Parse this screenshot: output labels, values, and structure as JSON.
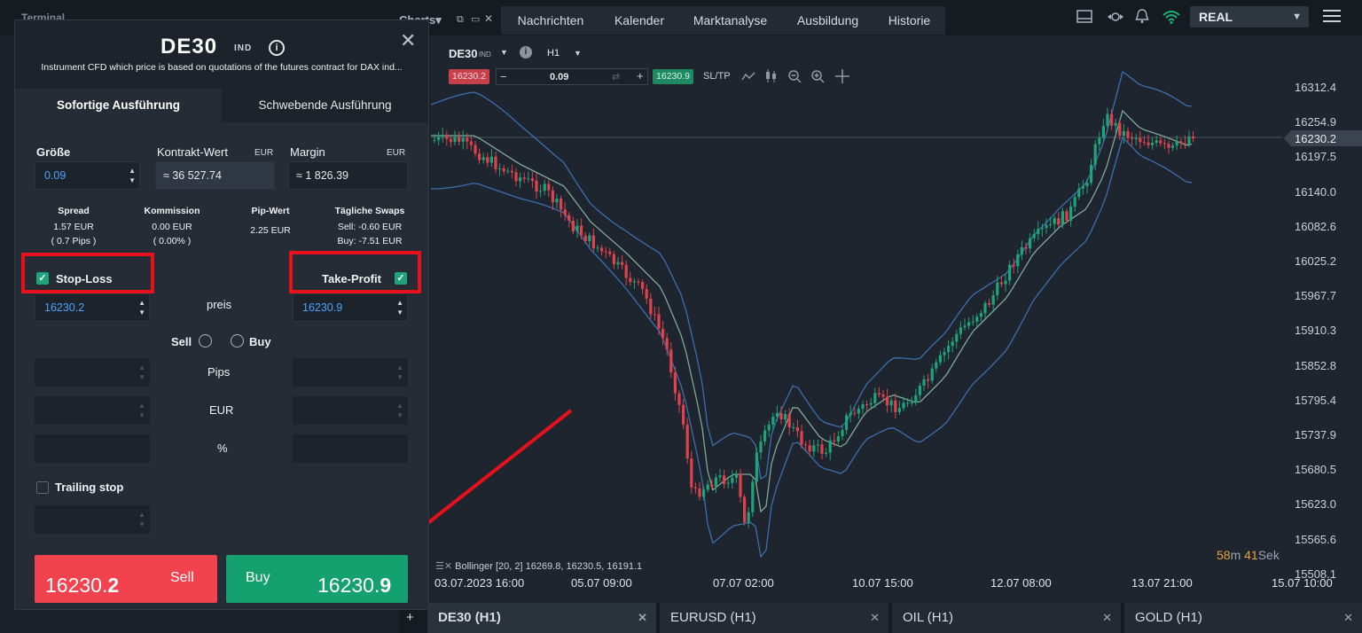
{
  "top_nav": {
    "terminal_label": "Terminal",
    "charts_label": "Charts",
    "tabs": [
      "Nachrichten",
      "Kalender",
      "Marktanalyse",
      "Ausbildung",
      "Historie"
    ],
    "account_mode": "REAL"
  },
  "order_panel": {
    "symbol": "DE30",
    "symbol_type": "IND",
    "description": "Instrument CFD which price is based on quotations of the futures contract for DAX ind...",
    "tab_instant": "Sofortige Ausführung",
    "tab_pending": "Schwebende Ausführung",
    "size_label": "Größe",
    "size_value": "0.09",
    "contract_label": "Kontrakt-Wert",
    "contract_unit": "EUR",
    "contract_value": "≈ 36 527.74",
    "margin_label": "Margin",
    "margin_unit": "EUR",
    "margin_value": "≈ 1 826.39",
    "stats": {
      "spread_label": "Spread",
      "spread_value": "1.57 EUR",
      "spread_pips": "( 0.7 Pips )",
      "commission_label": "Kommission",
      "commission_value": "0.00 EUR",
      "commission_pct": "( 0.00% )",
      "pip_label": "Pip-Wert",
      "pip_value": "2.25 EUR",
      "swaps_label": "Tägliche Swaps",
      "swaps_sell": "Sell: -0.60 EUR",
      "swaps_buy": "Buy: -7.51 EUR"
    },
    "stop_loss_label": "Stop-Loss",
    "stop_loss_value": "16230.2",
    "take_profit_label": "Take-Profit",
    "take_profit_value": "16230.9",
    "price_label": "preis",
    "sell_radio_label": "Sell",
    "buy_radio_label": "Buy",
    "pips_label": "Pips",
    "eur_label": "EUR",
    "pct_label": "%",
    "trailing_label": "Trailing stop",
    "sell_button": {
      "price_main": "16230.",
      "price_big": "2",
      "label": "Sell"
    },
    "buy_button": {
      "label": "Buy",
      "price_main": "16230.",
      "price_big": "9"
    }
  },
  "chart_toolbar": {
    "symbol": "DE30",
    "symbol_type": "IND",
    "timeframe": "H1",
    "bid": "16230.2",
    "volume": "0.09",
    "ask": "16230.9",
    "sltp": "SL/TP"
  },
  "chart": {
    "current_price": "16230.2",
    "y_ticks": [
      "16312.4",
      "16254.9",
      "16197.5",
      "16140.0",
      "16082.6",
      "16025.2",
      "15967.7",
      "15910.3",
      "15852.8",
      "15795.4",
      "15737.9",
      "15680.5",
      "15623.0",
      "15565.6",
      "15508.1"
    ],
    "x_ticks": [
      "03.07.2023 16:00",
      "05.07 09:00",
      "07.07 02:00",
      "10.07 15:00",
      "12.07 08:00",
      "13.07 21:00",
      "15.07 10:00"
    ],
    "indicator": "Bollinger [20, 2] 16269.8, 16230.5, 16191.1",
    "countdown_min": "58",
    "countdown_min_unit": "m",
    "countdown_sec": "41",
    "countdown_sec_unit": "Sek",
    "colors": {
      "bull": "#1fa37a",
      "bear": "#e0414c",
      "band": "#3b6fb0",
      "mid": "#7fa99a"
    }
  },
  "chart_tabs": [
    "DE30 (H1)",
    "EURUSD (H1)",
    "OIL (H1)",
    "GOLD (H1)"
  ],
  "chart_tab_add": "+"
}
